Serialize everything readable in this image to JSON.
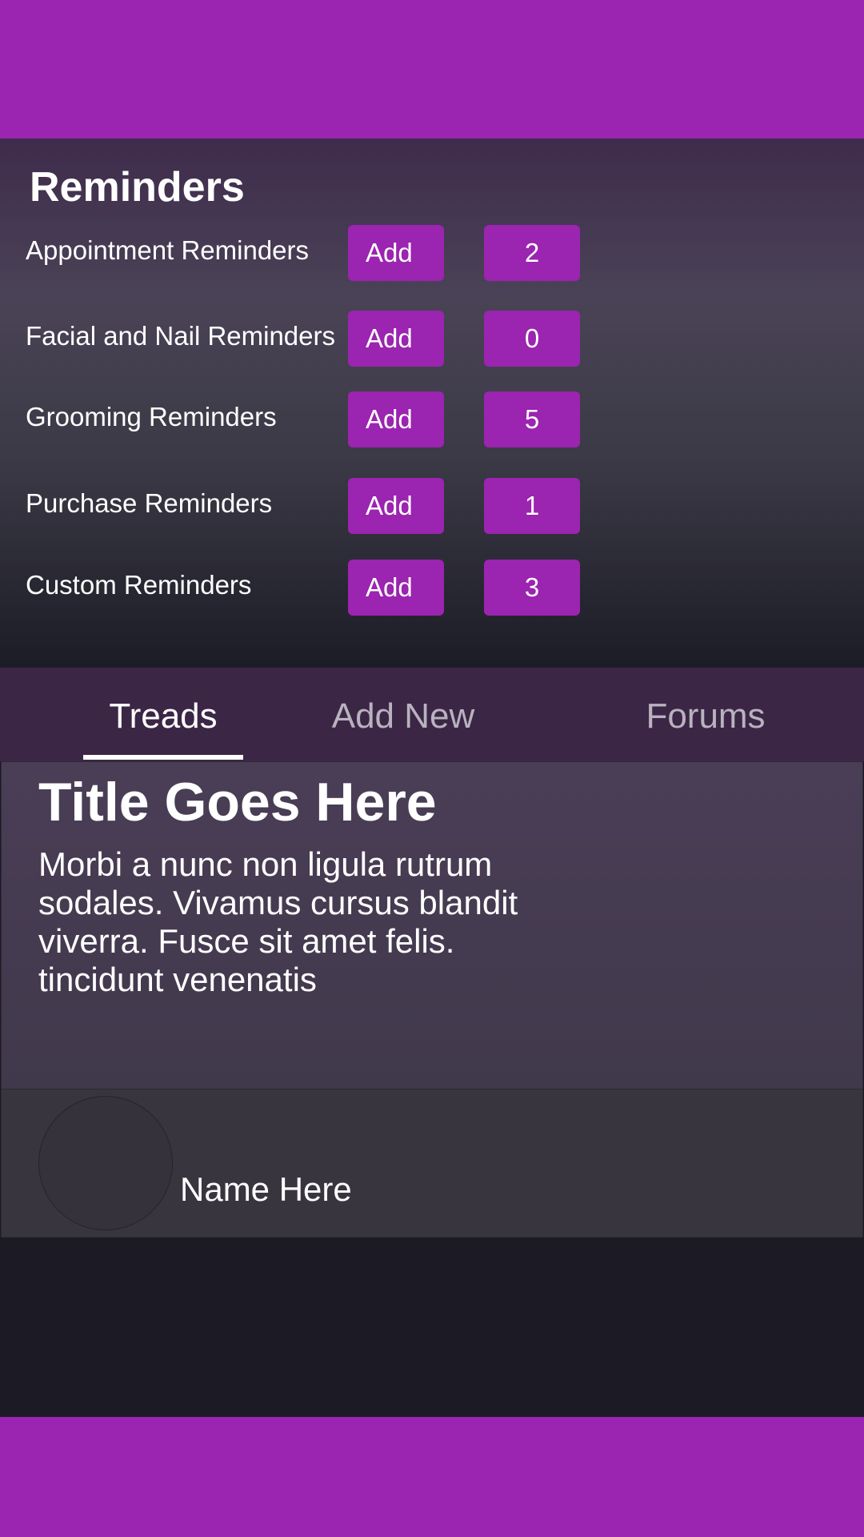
{
  "reminders": {
    "title": "Reminders",
    "add_label": "Add",
    "items": [
      {
        "label": "Appointment Reminders",
        "count": "2"
      },
      {
        "label": "Facial and Nail Reminders",
        "count": "0"
      },
      {
        "label": "Grooming Reminders",
        "count": "5"
      },
      {
        "label": "Purchase Reminders",
        "count": "1"
      },
      {
        "label": "Custom Reminders",
        "count": "3"
      }
    ]
  },
  "tabs": [
    {
      "label": "Treads",
      "active": true
    },
    {
      "label": "Add New",
      "active": false
    },
    {
      "label": "Forums",
      "active": false
    }
  ],
  "thread": {
    "title": "Title Goes Here",
    "body": "Morbi a nunc non ligula rutrum sodales. Vivamus cursus blandit viverra. Fusce sit amet felis. tincidunt venenatis",
    "author": "Name Here"
  },
  "colors": {
    "accent": "#9b24b0",
    "background": "#1c1a25"
  }
}
